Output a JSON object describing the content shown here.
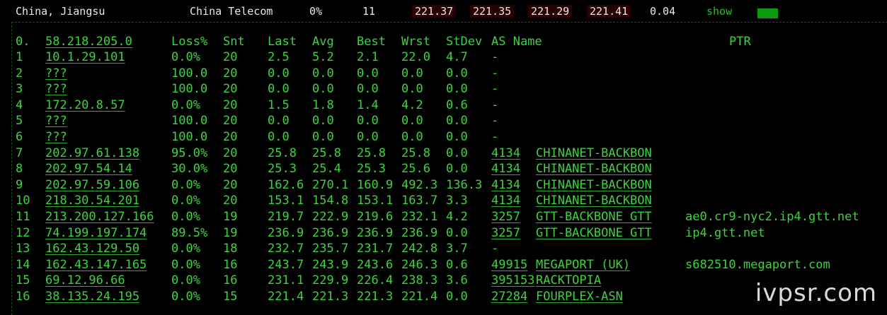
{
  "summary": {
    "location": "China, Jiangsu",
    "isp": "China Telecom",
    "loss": "0%",
    "hops": "11",
    "v1": "221.37",
    "v2": "221.35",
    "v3": "221.29",
    "v4": "221.41",
    "v5": "0.04",
    "show_label": "show",
    "indicator_color": "#0b9a0b"
  },
  "table": {
    "headers": {
      "hop": "0.",
      "host": "58.218.205.0",
      "loss": "Loss%",
      "snt": "Snt",
      "last": "Last",
      "avg": "Avg",
      "best": "Best",
      "wrst": "Wrst",
      "stdev": "StDev",
      "asname": "AS Name",
      "ptr": "PTR"
    },
    "rows": [
      {
        "hop": "1",
        "host": "10.1.29.101",
        "loss": "0.0%",
        "snt": "20",
        "last": "2.5",
        "avg": "5.2",
        "best": "2.1",
        "wrst": "22.0",
        "stdev": "4.7",
        "asn": "-",
        "as_name": "",
        "ptr": ""
      },
      {
        "hop": "2",
        "host": "???",
        "loss": "100.0",
        "snt": "20",
        "last": "0.0",
        "avg": "0.0",
        "best": "0.0",
        "wrst": "0.0",
        "stdev": "0.0",
        "asn": "-",
        "as_name": "",
        "ptr": ""
      },
      {
        "hop": "3",
        "host": "???",
        "loss": "100.0",
        "snt": "20",
        "last": "0.0",
        "avg": "0.0",
        "best": "0.0",
        "wrst": "0.0",
        "stdev": "0.0",
        "asn": "-",
        "as_name": "",
        "ptr": ""
      },
      {
        "hop": "4",
        "host": "172.20.8.57",
        "loss": "0.0%",
        "snt": "20",
        "last": "1.5",
        "avg": "1.8",
        "best": "1.4",
        "wrst": "4.2",
        "stdev": "0.6",
        "asn": "-",
        "as_name": "",
        "ptr": ""
      },
      {
        "hop": "5",
        "host": "???",
        "loss": "100.0",
        "snt": "20",
        "last": "0.0",
        "avg": "0.0",
        "best": "0.0",
        "wrst": "0.0",
        "stdev": "0.0",
        "asn": "-",
        "as_name": "",
        "ptr": ""
      },
      {
        "hop": "6",
        "host": "???",
        "loss": "100.0",
        "snt": "20",
        "last": "0.0",
        "avg": "0.0",
        "best": "0.0",
        "wrst": "0.0",
        "stdev": "0.0",
        "asn": "-",
        "as_name": "",
        "ptr": ""
      },
      {
        "hop": "7",
        "host": "202.97.61.138",
        "loss": "95.0%",
        "snt": "20",
        "last": "25.8",
        "avg": "25.8",
        "best": "25.8",
        "wrst": "25.8",
        "stdev": "0.0",
        "asn": "4134",
        "as_name": "CHINANET-BACKBON",
        "ptr": ""
      },
      {
        "hop": "8",
        "host": "202.97.54.14",
        "loss": "30.0%",
        "snt": "20",
        "last": "25.3",
        "avg": "25.4",
        "best": "25.3",
        "wrst": "25.6",
        "stdev": "0.0",
        "asn": "4134",
        "as_name": "CHINANET-BACKBON",
        "ptr": ""
      },
      {
        "hop": "9",
        "host": "202.97.59.106",
        "loss": "0.0%",
        "snt": "20",
        "last": "162.6",
        "avg": "270.1",
        "best": "160.9",
        "wrst": "492.3",
        "stdev": "136.3",
        "asn": "4134",
        "as_name": "CHINANET-BACKBON",
        "ptr": ""
      },
      {
        "hop": "10",
        "host": "218.30.54.201",
        "loss": "0.0%",
        "snt": "20",
        "last": "153.1",
        "avg": "154.8",
        "best": "153.1",
        "wrst": "163.7",
        "stdev": "3.3",
        "asn": "4134",
        "as_name": "CHINANET-BACKBON",
        "ptr": ""
      },
      {
        "hop": "11",
        "host": "213.200.127.166",
        "loss": "0.0%",
        "snt": "19",
        "last": "219.7",
        "avg": "222.9",
        "best": "219.6",
        "wrst": "232.1",
        "stdev": "4.2",
        "asn": "3257",
        "as_name": "GTT-BACKBONE GTT",
        "ptr": "ae0.cr9-nyc2.ip4.gtt.net"
      },
      {
        "hop": "12",
        "host": "74.199.197.174",
        "loss": "89.5%",
        "snt": "19",
        "last": "236.9",
        "avg": "236.9",
        "best": "236.9",
        "wrst": "236.9",
        "stdev": "0.0",
        "asn": "3257",
        "as_name": "GTT-BACKBONE GTT",
        "ptr": "ip4.gtt.net"
      },
      {
        "hop": "13",
        "host": "162.43.129.50",
        "loss": "0.0%",
        "snt": "18",
        "last": "232.7",
        "avg": "235.7",
        "best": "231.7",
        "wrst": "242.8",
        "stdev": "3.7",
        "asn": "-",
        "as_name": "",
        "ptr": ""
      },
      {
        "hop": "14",
        "host": "162.43.147.165",
        "loss": "0.0%",
        "snt": "16",
        "last": "243.7",
        "avg": "243.9",
        "best": "243.6",
        "wrst": "246.3",
        "stdev": "0.6",
        "asn": "49915",
        "as_name": "MEGAPORT (UK)",
        "ptr": "s682510.megaport.com"
      },
      {
        "hop": "15",
        "host": "69.12.96.66",
        "loss": "0.0%",
        "snt": "16",
        "last": "231.1",
        "avg": "229.9",
        "best": "226.4",
        "wrst": "238.3",
        "stdev": "3.6",
        "asn": "395153",
        "as_name": "RACKTOPIA",
        "ptr": ""
      },
      {
        "hop": "16",
        "host": "38.135.24.195",
        "loss": "0.0%",
        "snt": "15",
        "last": "221.4",
        "avg": "221.3",
        "best": "221.3",
        "wrst": "221.4",
        "stdev": "0.0",
        "asn": "27284",
        "as_name": "FOURPLEX-ASN",
        "ptr": ""
      }
    ]
  },
  "watermark": "ivpsr.com",
  "colors": {
    "text_green": "#3ed23e",
    "summary_text": "#e8e8e8",
    "background": "#000000"
  }
}
